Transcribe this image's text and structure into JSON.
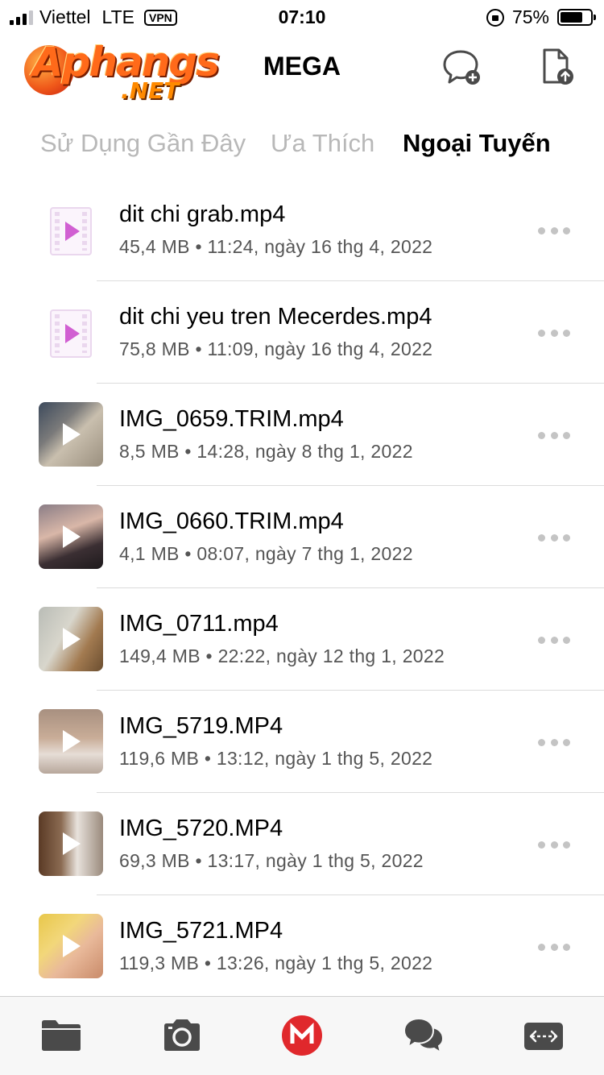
{
  "status_bar": {
    "carrier": "Viettel",
    "network": "LTE",
    "vpn": "VPN",
    "time": "07:10",
    "battery_percent": "75%",
    "battery_level": 0.75
  },
  "header": {
    "logo_text": "Aphangs",
    "logo_sub": ".NET",
    "title": "MEGA"
  },
  "tabs": [
    {
      "label": "Sử Dụng Gần Đây"
    },
    {
      "label": "Ưa Thích"
    },
    {
      "label": "Ngoại Tuyến",
      "selected": true
    }
  ],
  "files": [
    {
      "name": "dit chi grab.mp4",
      "meta": "45,4 MB • 11:24, ngày 16 thg 4, 2022",
      "thumb": "video-file-icon"
    },
    {
      "name": "dit chi yeu tren Mecerdes.mp4",
      "meta": "75,8 MB • 11:09, ngày 16 thg 4, 2022",
      "thumb": "video-file-icon"
    },
    {
      "name": "IMG_0659.TRIM.mp4",
      "meta": "8,5 MB • 14:28, ngày 8 thg 1, 2022",
      "thumb": "video-thumbnail"
    },
    {
      "name": "IMG_0660.TRIM.mp4",
      "meta": "4,1 MB • 08:07, ngày 7 thg 1, 2022",
      "thumb": "video-thumbnail"
    },
    {
      "name": "IMG_0711.mp4",
      "meta": "149,4 MB • 22:22, ngày 12 thg 1, 2022",
      "thumb": "video-thumbnail"
    },
    {
      "name": "IMG_5719.MP4",
      "meta": "119,6 MB • 13:12, ngày 1 thg 5, 2022",
      "thumb": "video-thumbnail"
    },
    {
      "name": "IMG_5720.MP4",
      "meta": "69,3 MB • 13:17, ngày 1 thg 5, 2022",
      "thumb": "video-thumbnail"
    },
    {
      "name": "IMG_5721.MP4",
      "meta": "119,3 MB • 13:26, ngày 1 thg 5, 2022",
      "thumb": "video-thumbnail"
    }
  ],
  "tabbar": [
    {
      "icon": "folder-icon"
    },
    {
      "icon": "camera-icon"
    },
    {
      "icon": "mega-home-icon"
    },
    {
      "icon": "chat-icon"
    },
    {
      "icon": "transfers-icon"
    }
  ],
  "colors": {
    "mega_red": "#e0282c",
    "icon_gray": "#4a4a4a",
    "inactive_tab": "#b8b8b8",
    "video_pink": "#d15fd2"
  }
}
